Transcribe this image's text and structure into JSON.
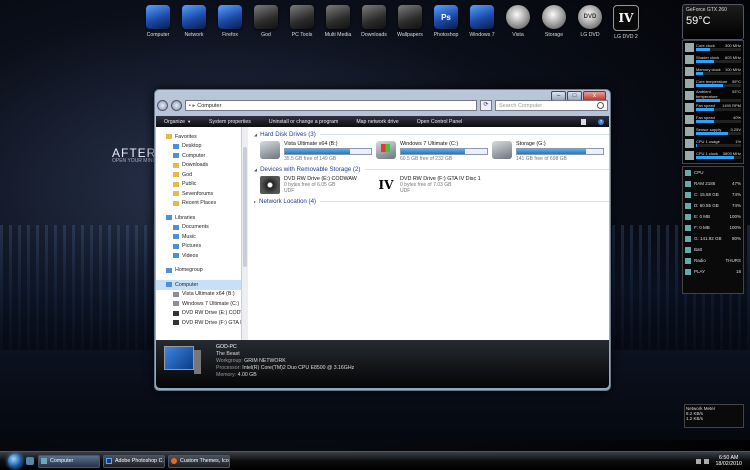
{
  "wallpaper": {
    "title": "AFTER MI",
    "subtitle": "OPEN YOUR MIND"
  },
  "dock": [
    {
      "label": "Computer",
      "icon": "computer-icon"
    },
    {
      "label": "Network",
      "icon": "network-icon"
    },
    {
      "label": "Firefox",
      "icon": "firefox-icon"
    },
    {
      "label": "God",
      "icon": "god-icon"
    },
    {
      "label": "PC Tools",
      "icon": "pc-tools-icon"
    },
    {
      "label": "Multi Media",
      "icon": "multimedia-icon"
    },
    {
      "label": "Downloads",
      "icon": "downloads-icon"
    },
    {
      "label": "Wallpapers",
      "icon": "wallpapers-icon"
    },
    {
      "label": "Photoshop",
      "icon": "photoshop-icon",
      "glyph": "Ps"
    },
    {
      "label": "Windows 7",
      "icon": "windows7-icon"
    },
    {
      "label": "Vista",
      "icon": "vista-icon"
    },
    {
      "label": "Storage",
      "icon": "storage-icon"
    },
    {
      "label": "LG DVD",
      "icon": "lg-dvd-icon",
      "glyph": "DVD"
    },
    {
      "label": "LG DVD 2",
      "icon": "lg-dvd2-icon",
      "glyph": "IV"
    }
  ],
  "gpu_gadget": {
    "name": "GeForce GTX 260",
    "temp": "59°C"
  },
  "gpu_stats": [
    {
      "label": "Core clock",
      "value": "300 MHz",
      "pct": 30
    },
    {
      "label": "Shader clock",
      "value": "603 MHz",
      "pct": 40
    },
    {
      "label": "Memory clock",
      "value": "100 MHz",
      "pct": 15
    },
    {
      "label": "Core temperature",
      "value": "59°C",
      "pct": 59
    },
    {
      "label": "Ambient temperature",
      "value": "53°C",
      "pct": 53
    },
    {
      "label": "Fan speed",
      "value": "1490 RPM",
      "pct": 40
    },
    {
      "label": "Fan speed",
      "value": "40%",
      "pct": 40
    },
    {
      "label": "Sensor supply",
      "value": "3.25V",
      "pct": 70
    },
    {
      "label": "CPU 1 usage",
      "value": "1%",
      "pct": 1
    },
    {
      "label": "CPU 1 clock",
      "value": "3805 MHz",
      "pct": 85
    }
  ],
  "sys_gadget": {
    "rows": [
      {
        "label": "CPU",
        "value": ""
      },
      {
        "label": "RAM 2185",
        "value": "47%"
      },
      {
        "label": "C: 15.58 GB",
        "value": "74%"
      },
      {
        "label": "D: 60.55 GB",
        "value": "74%"
      },
      {
        "label": "E: 0 MB",
        "value": "100%"
      },
      {
        "label": "F: 0 MB",
        "value": "100%"
      },
      {
        "label": "G: 141.92 GB",
        "value": "80%"
      },
      {
        "label": "Batt",
        "value": ""
      },
      {
        "label": "Radio",
        "value": "THURS"
      },
      {
        "label": "PLAY",
        "value": "18"
      }
    ]
  },
  "net_gadget": {
    "title": "Network Meter",
    "up": "8.2 KB/s",
    "down": "1.2 KB/s"
  },
  "explorer": {
    "address_path": "Computer",
    "search_placeholder": "Search Computer",
    "buttons": {
      "minimize": "–",
      "maximize": "□",
      "close": "x"
    },
    "commands": [
      "Organize",
      "System properties",
      "Uninstall or change a program",
      "Map network drive",
      "Open Control Panel"
    ],
    "nav": [
      {
        "label": "Favorites",
        "type": "header",
        "icon": "star-icon"
      },
      {
        "label": "Desktop",
        "type": "item",
        "icon": "desktop-icon"
      },
      {
        "label": "Computer",
        "type": "item",
        "icon": "computer-icon"
      },
      {
        "label": "Downloads",
        "type": "item",
        "icon": "downloads-icon"
      },
      {
        "label": "God",
        "type": "item",
        "icon": "folder-icon"
      },
      {
        "label": "Public",
        "type": "item",
        "icon": "folder-icon"
      },
      {
        "label": "Sevenforums",
        "type": "item",
        "icon": "folder-icon"
      },
      {
        "label": "Recent Places",
        "type": "item",
        "icon": "recent-places-icon"
      },
      {
        "label": "Libraries",
        "type": "header",
        "icon": "library-icon"
      },
      {
        "label": "Documents",
        "type": "item",
        "icon": "documents-icon"
      },
      {
        "label": "Music",
        "type": "item",
        "icon": "music-icon"
      },
      {
        "label": "Pictures",
        "type": "item",
        "icon": "pictures-icon"
      },
      {
        "label": "Videos",
        "type": "item",
        "icon": "videos-icon"
      },
      {
        "label": "Homegroup",
        "type": "header",
        "icon": "homegroup-icon"
      },
      {
        "label": "Computer",
        "type": "header",
        "icon": "computer-icon",
        "selected": true
      },
      {
        "label": "Vista Ultimate x64 (B:)",
        "type": "item",
        "icon": "drive-icon"
      },
      {
        "label": "Windows 7 Ultimate (C:)",
        "type": "item",
        "icon": "drive-icon"
      },
      {
        "label": "DVD RW Drive (E:) CODWAW",
        "type": "item",
        "icon": "dvd-icon"
      },
      {
        "label": "DVD RW Drive (F:) GTA IV",
        "type": "item",
        "icon": "dvd-icon"
      }
    ],
    "groups": {
      "hdd": {
        "title": "Hard Disk Drives (3)"
      },
      "removable": {
        "title": "Devices with Removable Storage (2)"
      },
      "network": {
        "title": "Network Location (4)"
      }
    },
    "hard_drives": [
      {
        "name": "Vista Ultimate x64 (B:)",
        "free": "35.5 GB free of 149 GB",
        "used_pct": 76,
        "icon": "hard-drive-icon"
      },
      {
        "name": "Windows 7 Ultimate (C:)",
        "free": "60.5 GB free of 232 GB",
        "used_pct": 74,
        "icon": "windows-drive-icon"
      },
      {
        "name": "Storage (G:)",
        "free": "141 GB free of 698 GB",
        "used_pct": 80,
        "icon": "hard-drive-icon"
      }
    ],
    "removable": [
      {
        "name": "DVD RW Drive (E:) CODWAW",
        "free": "0 bytes free of 6.05 GB",
        "fs": "UDF",
        "icon": "dvd-drive-icon"
      },
      {
        "name": "DVD RW Drive (F:) GTA IV Disc 1",
        "free": "0 bytes free of 7.03 GB",
        "fs": "UDF",
        "icon": "gta-iv-disc-icon",
        "glyph": "IV"
      }
    ],
    "details": {
      "pc_name": "GOD-PC",
      "pc_desc": "The Beast",
      "workgroup_label": "Workgroup:",
      "workgroup": "GRIM NETWORK",
      "processor_label": "Processor:",
      "processor": "Intel(R) Core(TM)2 Duo CPU     E8500  @ 3.16GHz",
      "memory_label": "Memory:",
      "memory": "4.00 GB"
    }
  },
  "taskbar": {
    "tasks": [
      {
        "label": "Computer",
        "icon": "computer-icon",
        "active": true
      },
      {
        "label": "Adobe Photoshop C...",
        "icon": "photoshop-icon"
      },
      {
        "label": "Custom Themes, Ico...",
        "icon": "firefox-icon"
      }
    ],
    "time": "6:50 AM",
    "date": "18/02/2010"
  }
}
